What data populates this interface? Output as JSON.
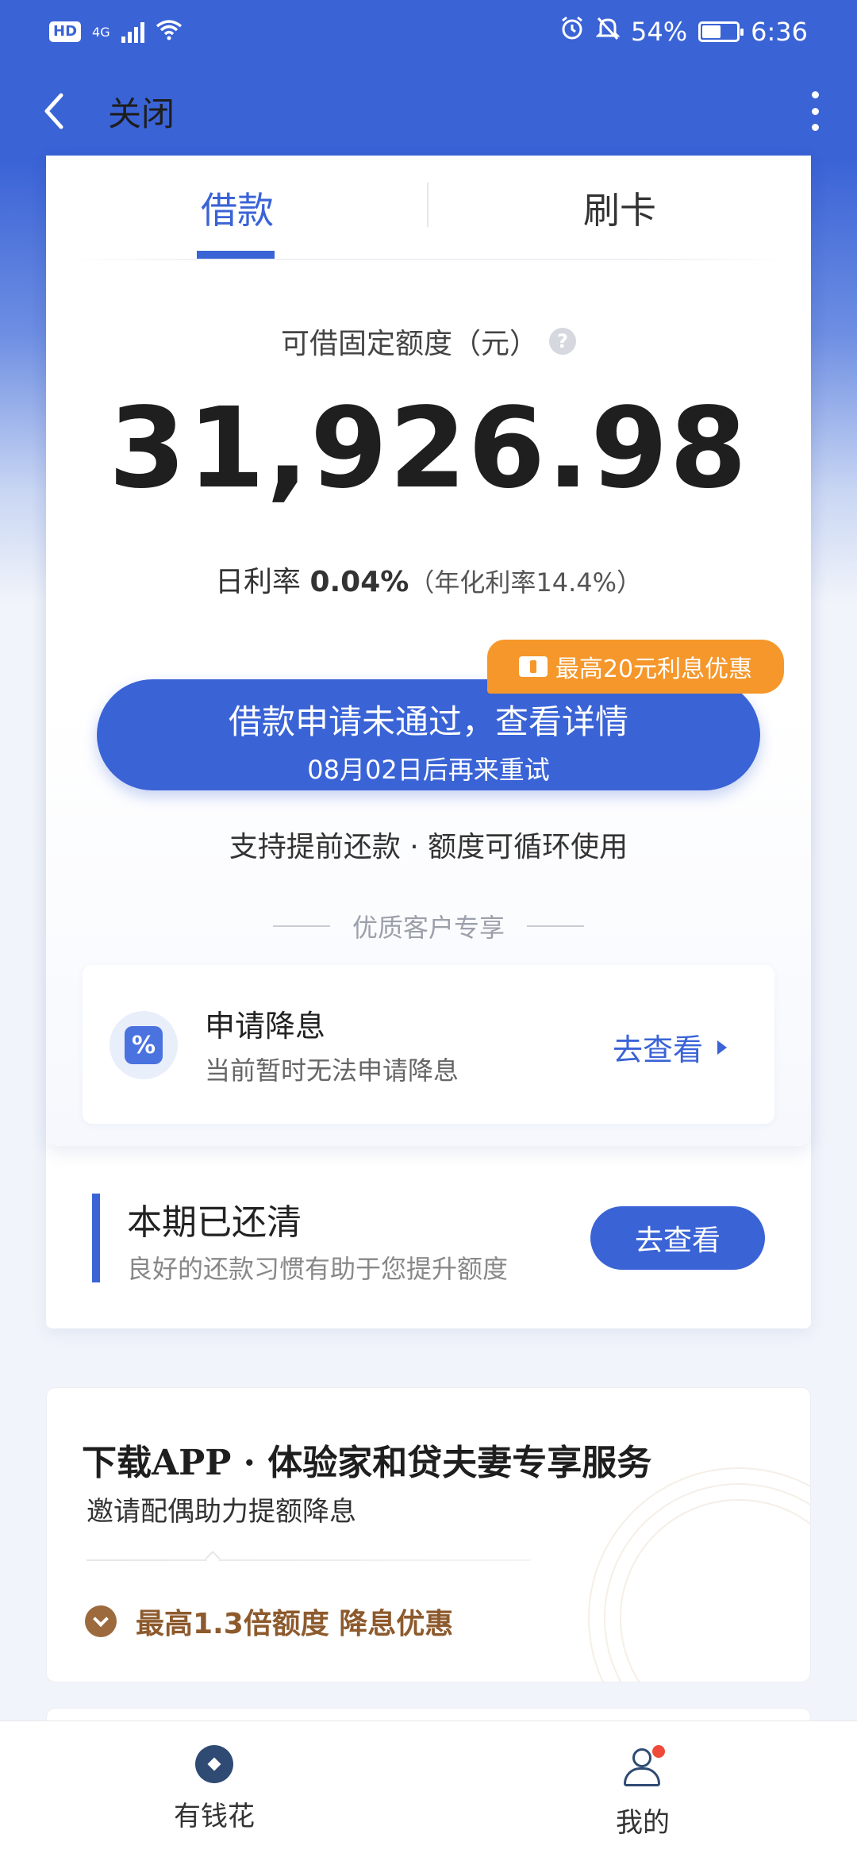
{
  "status_bar": {
    "hd": "HD",
    "network": "4G",
    "battery": "54%",
    "battery_level": 0.54,
    "time": "6:36"
  },
  "nav": {
    "close_label": "关闭"
  },
  "tabs": [
    {
      "label": "借款",
      "active": true
    },
    {
      "label": "刷卡",
      "active": false
    }
  ],
  "loan": {
    "limit_label": "可借固定额度（元）",
    "help_symbol": "?",
    "amount": "31,926.98",
    "rate_prefix": "日利率",
    "rate_value": "0.04%",
    "rate_annual": "（年化利率14.4%）",
    "promo_badge": "最高20元利息优惠",
    "button_line1": "借款申请未通过，查看详情",
    "button_line2": "08月02日后再来重试",
    "support_text": "支持提前还款 · 额度可循环使用"
  },
  "premium": {
    "section_title": "优质客户专享",
    "card_title": "申请降息",
    "card_subtitle": "当前暂时无法申请降息",
    "card_link": "去查看",
    "icon_symbol": "%"
  },
  "repay": {
    "title": "本期已还清",
    "subtitle": "良好的还款习惯有助于您提升额度",
    "button": "去查看"
  },
  "promo": {
    "title": "下载APP · 体验家和贷夫妻专享服务",
    "subtitle": "邀请配偶助力提额降息",
    "benefit": "最高1.3倍额度 降息优惠"
  },
  "bottom_nav": [
    {
      "label": "有钱花",
      "icon": "home-icon"
    },
    {
      "label": "我的",
      "icon": "user-icon"
    }
  ],
  "colors": {
    "brand": "#3a63d6",
    "promo_orange": "#f5972b",
    "benefit_brown": "#8d5a2d"
  }
}
